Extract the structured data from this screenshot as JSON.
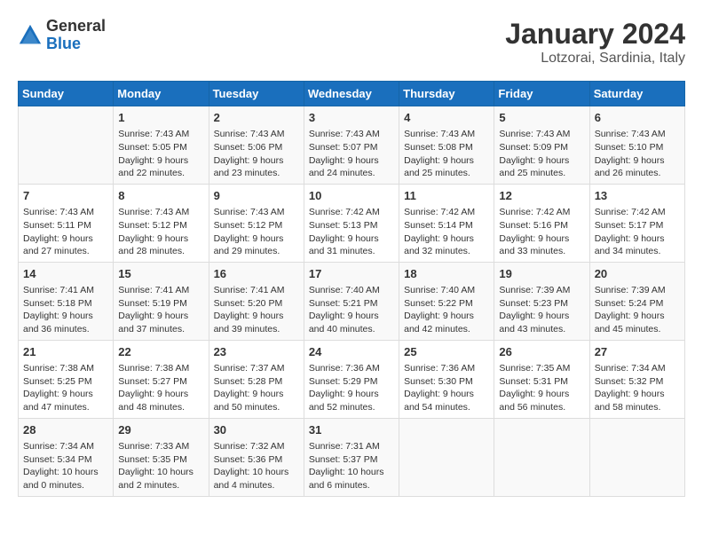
{
  "logo": {
    "general": "General",
    "blue": "Blue"
  },
  "title": "January 2024",
  "subtitle": "Lotzorai, Sardinia, Italy",
  "weekdays": [
    "Sunday",
    "Monday",
    "Tuesday",
    "Wednesday",
    "Thursday",
    "Friday",
    "Saturday"
  ],
  "weeks": [
    [
      {
        "day": null,
        "info": null
      },
      {
        "day": "1",
        "sunrise": "Sunrise: 7:43 AM",
        "sunset": "Sunset: 5:05 PM",
        "daylight": "Daylight: 9 hours and 22 minutes."
      },
      {
        "day": "2",
        "sunrise": "Sunrise: 7:43 AM",
        "sunset": "Sunset: 5:06 PM",
        "daylight": "Daylight: 9 hours and 23 minutes."
      },
      {
        "day": "3",
        "sunrise": "Sunrise: 7:43 AM",
        "sunset": "Sunset: 5:07 PM",
        "daylight": "Daylight: 9 hours and 24 minutes."
      },
      {
        "day": "4",
        "sunrise": "Sunrise: 7:43 AM",
        "sunset": "Sunset: 5:08 PM",
        "daylight": "Daylight: 9 hours and 25 minutes."
      },
      {
        "day": "5",
        "sunrise": "Sunrise: 7:43 AM",
        "sunset": "Sunset: 5:09 PM",
        "daylight": "Daylight: 9 hours and 25 minutes."
      },
      {
        "day": "6",
        "sunrise": "Sunrise: 7:43 AM",
        "sunset": "Sunset: 5:10 PM",
        "daylight": "Daylight: 9 hours and 26 minutes."
      }
    ],
    [
      {
        "day": "7",
        "sunrise": "Sunrise: 7:43 AM",
        "sunset": "Sunset: 5:11 PM",
        "daylight": "Daylight: 9 hours and 27 minutes."
      },
      {
        "day": "8",
        "sunrise": "Sunrise: 7:43 AM",
        "sunset": "Sunset: 5:12 PM",
        "daylight": "Daylight: 9 hours and 28 minutes."
      },
      {
        "day": "9",
        "sunrise": "Sunrise: 7:43 AM",
        "sunset": "Sunset: 5:12 PM",
        "daylight": "Daylight: 9 hours and 29 minutes."
      },
      {
        "day": "10",
        "sunrise": "Sunrise: 7:42 AM",
        "sunset": "Sunset: 5:13 PM",
        "daylight": "Daylight: 9 hours and 31 minutes."
      },
      {
        "day": "11",
        "sunrise": "Sunrise: 7:42 AM",
        "sunset": "Sunset: 5:14 PM",
        "daylight": "Daylight: 9 hours and 32 minutes."
      },
      {
        "day": "12",
        "sunrise": "Sunrise: 7:42 AM",
        "sunset": "Sunset: 5:16 PM",
        "daylight": "Daylight: 9 hours and 33 minutes."
      },
      {
        "day": "13",
        "sunrise": "Sunrise: 7:42 AM",
        "sunset": "Sunset: 5:17 PM",
        "daylight": "Daylight: 9 hours and 34 minutes."
      }
    ],
    [
      {
        "day": "14",
        "sunrise": "Sunrise: 7:41 AM",
        "sunset": "Sunset: 5:18 PM",
        "daylight": "Daylight: 9 hours and 36 minutes."
      },
      {
        "day": "15",
        "sunrise": "Sunrise: 7:41 AM",
        "sunset": "Sunset: 5:19 PM",
        "daylight": "Daylight: 9 hours and 37 minutes."
      },
      {
        "day": "16",
        "sunrise": "Sunrise: 7:41 AM",
        "sunset": "Sunset: 5:20 PM",
        "daylight": "Daylight: 9 hours and 39 minutes."
      },
      {
        "day": "17",
        "sunrise": "Sunrise: 7:40 AM",
        "sunset": "Sunset: 5:21 PM",
        "daylight": "Daylight: 9 hours and 40 minutes."
      },
      {
        "day": "18",
        "sunrise": "Sunrise: 7:40 AM",
        "sunset": "Sunset: 5:22 PM",
        "daylight": "Daylight: 9 hours and 42 minutes."
      },
      {
        "day": "19",
        "sunrise": "Sunrise: 7:39 AM",
        "sunset": "Sunset: 5:23 PM",
        "daylight": "Daylight: 9 hours and 43 minutes."
      },
      {
        "day": "20",
        "sunrise": "Sunrise: 7:39 AM",
        "sunset": "Sunset: 5:24 PM",
        "daylight": "Daylight: 9 hours and 45 minutes."
      }
    ],
    [
      {
        "day": "21",
        "sunrise": "Sunrise: 7:38 AM",
        "sunset": "Sunset: 5:25 PM",
        "daylight": "Daylight: 9 hours and 47 minutes."
      },
      {
        "day": "22",
        "sunrise": "Sunrise: 7:38 AM",
        "sunset": "Sunset: 5:27 PM",
        "daylight": "Daylight: 9 hours and 48 minutes."
      },
      {
        "day": "23",
        "sunrise": "Sunrise: 7:37 AM",
        "sunset": "Sunset: 5:28 PM",
        "daylight": "Daylight: 9 hours and 50 minutes."
      },
      {
        "day": "24",
        "sunrise": "Sunrise: 7:36 AM",
        "sunset": "Sunset: 5:29 PM",
        "daylight": "Daylight: 9 hours and 52 minutes."
      },
      {
        "day": "25",
        "sunrise": "Sunrise: 7:36 AM",
        "sunset": "Sunset: 5:30 PM",
        "daylight": "Daylight: 9 hours and 54 minutes."
      },
      {
        "day": "26",
        "sunrise": "Sunrise: 7:35 AM",
        "sunset": "Sunset: 5:31 PM",
        "daylight": "Daylight: 9 hours and 56 minutes."
      },
      {
        "day": "27",
        "sunrise": "Sunrise: 7:34 AM",
        "sunset": "Sunset: 5:32 PM",
        "daylight": "Daylight: 9 hours and 58 minutes."
      }
    ],
    [
      {
        "day": "28",
        "sunrise": "Sunrise: 7:34 AM",
        "sunset": "Sunset: 5:34 PM",
        "daylight": "Daylight: 10 hours and 0 minutes."
      },
      {
        "day": "29",
        "sunrise": "Sunrise: 7:33 AM",
        "sunset": "Sunset: 5:35 PM",
        "daylight": "Daylight: 10 hours and 2 minutes."
      },
      {
        "day": "30",
        "sunrise": "Sunrise: 7:32 AM",
        "sunset": "Sunset: 5:36 PM",
        "daylight": "Daylight: 10 hours and 4 minutes."
      },
      {
        "day": "31",
        "sunrise": "Sunrise: 7:31 AM",
        "sunset": "Sunset: 5:37 PM",
        "daylight": "Daylight: 10 hours and 6 minutes."
      },
      {
        "day": null,
        "info": null
      },
      {
        "day": null,
        "info": null
      },
      {
        "day": null,
        "info": null
      }
    ]
  ]
}
